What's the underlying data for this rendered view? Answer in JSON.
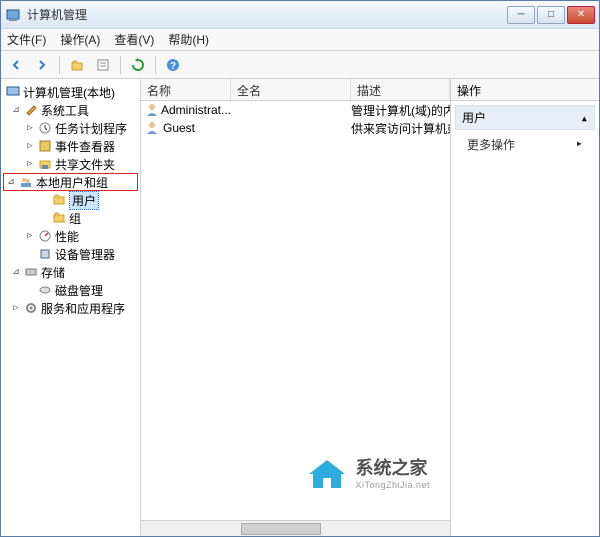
{
  "window": {
    "title": "计算机管理"
  },
  "menu": {
    "file": "文件(F)",
    "action": "操作(A)",
    "view": "查看(V)",
    "help": "帮助(H)"
  },
  "tree": {
    "root": "计算机管理(本地)",
    "system_tools": "系统工具",
    "task_scheduler": "任务计划程序",
    "event_viewer": "事件查看器",
    "shared_folders": "共享文件夹",
    "local_users": "本地用户和组",
    "users": "用户",
    "groups": "组",
    "performance": "性能",
    "device_manager": "设备管理器",
    "storage": "存储",
    "disk_mgmt": "磁盘管理",
    "services_apps": "服务和应用程序"
  },
  "list": {
    "col_name": "名称",
    "col_fullname": "全名",
    "col_desc": "描述",
    "rows": [
      {
        "name": "Administrat...",
        "full": "",
        "desc": "管理计算机(域)的内置帐户"
      },
      {
        "name": "Guest",
        "full": "",
        "desc": "供来宾访问计算机或访问域"
      }
    ]
  },
  "actions": {
    "header": "操作",
    "title": "用户",
    "more": "更多操作"
  },
  "watermark": {
    "cn": "系统之家",
    "en": "XiTongZhiJia.net"
  }
}
